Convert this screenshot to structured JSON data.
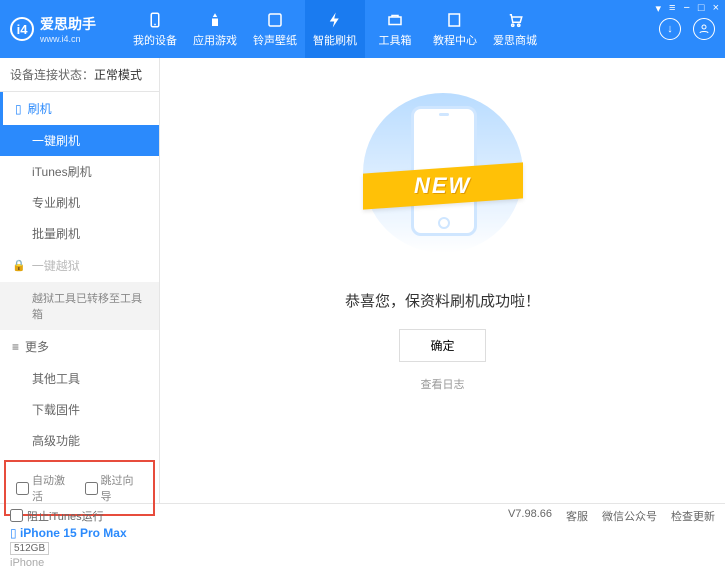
{
  "app": {
    "title": "爱思助手",
    "url": "www.i4.cn"
  },
  "nav": [
    {
      "label": "我的设备"
    },
    {
      "label": "应用游戏"
    },
    {
      "label": "铃声壁纸"
    },
    {
      "label": "智能刷机",
      "active": true
    },
    {
      "label": "工具箱"
    },
    {
      "label": "教程中心"
    },
    {
      "label": "爱思商城"
    }
  ],
  "status": {
    "label": "设备连接状态：",
    "value": "正常模式"
  },
  "sidebar": {
    "flash": {
      "title": "刷机",
      "items": [
        "一键刷机",
        "iTunes刷机",
        "专业刷机",
        "批量刷机"
      ]
    },
    "jailbreak": {
      "title": "一键越狱",
      "sub": "越狱工具已转移至工具箱"
    },
    "more": {
      "title": "更多",
      "items": [
        "其他工具",
        "下载固件",
        "高级功能"
      ]
    },
    "checks": {
      "auto_activate": "自动激活",
      "skip_guide": "跳过向导"
    },
    "device": {
      "name": "iPhone 15 Pro Max",
      "storage": "512GB",
      "type": "iPhone"
    }
  },
  "main": {
    "ribbon": "NEW",
    "success": "恭喜您，保资料刷机成功啦！",
    "confirm": "确定",
    "view_log": "查看日志"
  },
  "footer": {
    "block_itunes": "阻止iTunes运行",
    "version": "V7.98.66",
    "links": [
      "客服",
      "微信公众号",
      "检查更新"
    ]
  }
}
